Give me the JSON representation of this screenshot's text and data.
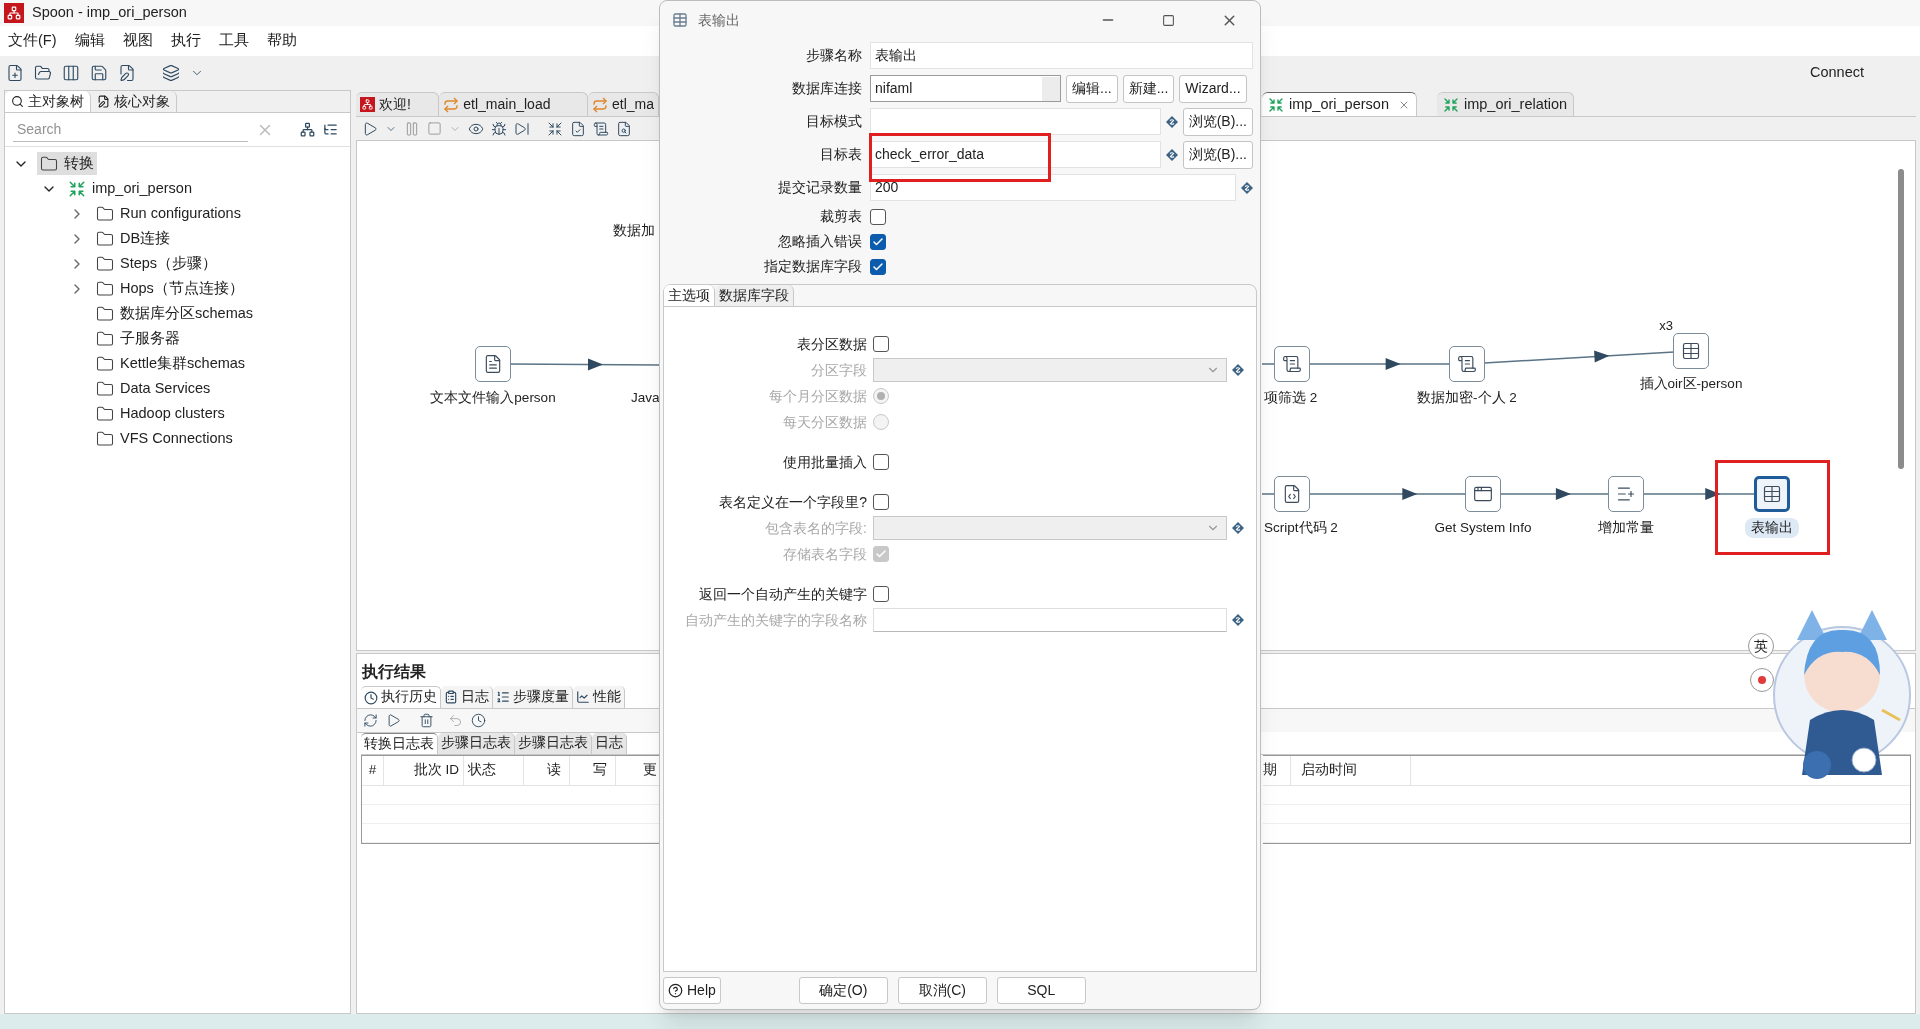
{
  "window": {
    "title": "Spoon - imp_ori_person"
  },
  "menu": [
    "文件(F)",
    "编辑",
    "视图",
    "执行",
    "工具",
    "帮助"
  ],
  "connect": "Connect",
  "left_panel": {
    "tabs": [
      {
        "label": "主对象树",
        "selected": true
      },
      {
        "label": "核心对象",
        "selected": false
      }
    ],
    "search": {
      "placeholder": "Search"
    },
    "tree": [
      {
        "label": "转换",
        "kind": "folder",
        "expanded": true,
        "selected": true,
        "children": [
          {
            "label": "imp_ori_person",
            "kind": "transform",
            "expanded": true,
            "selected": false,
            "children": [
              {
                "label": "Run configurations",
                "kind": "folder",
                "expanded": false,
                "selected": false
              },
              {
                "label": "DB连接",
                "kind": "folder",
                "expanded": false,
                "selected": false
              },
              {
                "label": "Steps（步骤）",
                "kind": "folder",
                "expanded": false,
                "selected": false
              },
              {
                "label": "Hops（节点连接）",
                "kind": "folder",
                "expanded": false,
                "selected": false
              },
              {
                "label": "数据库分区schemas",
                "kind": "folder",
                "selected": false
              },
              {
                "label": "子服务器",
                "kind": "folder",
                "selected": false
              },
              {
                "label": "Kettle集群schemas",
                "kind": "folder",
                "selected": false
              },
              {
                "label": "Data Services",
                "kind": "folder",
                "selected": false
              },
              {
                "label": "Hadoop clusters",
                "kind": "folder",
                "selected": false
              },
              {
                "label": "VFS Connections",
                "kind": "folder",
                "selected": false
              }
            ]
          }
        ]
      }
    ]
  },
  "editor_tabs": [
    {
      "label": "欢迎!",
      "kind": "welcome",
      "selected": false
    },
    {
      "label": "etl_main_load",
      "kind": "job",
      "selected": false
    },
    {
      "label": "etl_ma",
      "kind": "job",
      "selected": false
    }
  ],
  "editor_tabs_right": [
    {
      "label": "imp_ori_person",
      "kind": "transform",
      "selected": true,
      "closable": true
    },
    {
      "label": "imp_ori_relation",
      "kind": "transform",
      "selected": false,
      "closable": false
    }
  ],
  "canvas": {
    "nodes": [
      {
        "label": "文本文件输入person",
        "kind": "file",
        "selected": false
      },
      {
        "label": "数据加",
        "kind": "label"
      },
      {
        "label": "Java",
        "kind": "label"
      },
      {
        "label": "项筛选 2",
        "kind": "script",
        "selected": false
      },
      {
        "label": "数据加密-个人 2",
        "kind": "script",
        "selected": false
      },
      {
        "label": "插入oir区-person",
        "kind": "table",
        "selected": false,
        "badge": "x3"
      },
      {
        "label": "Script代码 2",
        "kind": "js",
        "selected": false
      },
      {
        "label": "Get System Info",
        "kind": "sysinfo",
        "selected": false
      },
      {
        "label": "增加常量",
        "kind": "constant",
        "selected": false
      },
      {
        "label": "表输出",
        "kind": "table",
        "selected": true,
        "highlighted": true
      }
    ]
  },
  "results": {
    "title": "执行结果",
    "tabs": [
      {
        "label": "执行历史",
        "kind": "history",
        "selected": true
      },
      {
        "label": "日志",
        "kind": "log",
        "selected": false
      },
      {
        "label": "步骤度量",
        "kind": "metrics",
        "selected": false
      },
      {
        "label": "性能",
        "kind": "perf",
        "selected": false
      }
    ],
    "sub_tabs": [
      {
        "label": "转换日志表",
        "selected": true
      },
      {
        "label": "步骤日志表",
        "selected": false
      },
      {
        "label": "步骤日志表",
        "selected": false
      },
      {
        "label": "日志",
        "selected": false
      }
    ],
    "columns": [
      "#",
      "批次 ID",
      "状态",
      "读",
      "写",
      "更"
    ],
    "columns_right": [
      "期",
      "启动时间"
    ]
  },
  "dialog": {
    "title": "表输出",
    "fields": [
      {
        "label": "步骤名称",
        "kind": "text",
        "value": "表输出"
      },
      {
        "label": "数据库连接",
        "kind": "combo",
        "value": "nifaml",
        "buttons": [
          "编辑...",
          "新建...",
          "Wizard..."
        ]
      },
      {
        "label": "目标模式",
        "kind": "var",
        "buttons": [
          "浏览(B)..."
        ]
      },
      {
        "label": "目标表",
        "kind": "var",
        "value": "check_error_data",
        "buttons": [
          "浏览(B)..."
        ],
        "highlighted": true
      },
      {
        "label": "提交记录数量",
        "kind": "var",
        "value": "200"
      },
      {
        "label": "裁剪表",
        "kind": "checkbox",
        "checked": false
      },
      {
        "label": "忽略插入错误",
        "kind": "checkbox",
        "checked": true
      },
      {
        "label": "指定数据库字段",
        "kind": "checkbox",
        "checked": true
      }
    ],
    "tabs": [
      {
        "label": "主选项",
        "selected": true
      },
      {
        "label": "数据库字段",
        "selected": false
      }
    ],
    "options": [
      {
        "label": "表分区数据",
        "kind": "checkbox",
        "checked": false,
        "disabled": false
      },
      {
        "label": "分区字段",
        "kind": "combo",
        "disabled": true
      },
      {
        "label": "每个月分区数据",
        "kind": "radio",
        "selected": true,
        "disabled": true
      },
      {
        "label": "每天分区数据",
        "kind": "radio",
        "selected": false,
        "disabled": true
      },
      {
        "label": "使用批量插入",
        "kind": "checkbox",
        "checked": false,
        "disabled": false
      },
      {
        "label": "表名定义在一个字段里?",
        "kind": "checkbox",
        "checked": false,
        "disabled": false
      },
      {
        "label": "包含表名的字段:",
        "kind": "combo",
        "disabled": true
      },
      {
        "label": "存储表名字段",
        "kind": "checkbox",
        "checked": true,
        "disabled": true
      },
      {
        "label": "返回一个自动产生的关键字",
        "kind": "checkbox",
        "checked": false,
        "disabled": false
      },
      {
        "label": "自动产生的关键字的字段名称",
        "kind": "var",
        "disabled": true
      }
    ],
    "help": "Help",
    "buttons": [
      "确定(O)",
      "取消(C)",
      "SQL"
    ]
  },
  "ime_indicator": "英"
}
